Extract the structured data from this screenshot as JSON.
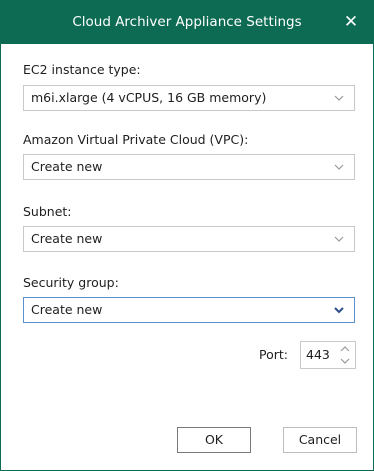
{
  "dialog": {
    "title": "Cloud Archiver Appliance Settings",
    "close_glyph": "✕"
  },
  "fields": {
    "instance_type": {
      "label": "EC2 instance type:",
      "value": "m6i.xlarge (4 vCPUS, 16 GB memory)"
    },
    "vpc": {
      "label": "Amazon Virtual Private Cloud (VPC):",
      "value": "Create new"
    },
    "subnet": {
      "label": "Subnet:",
      "value": "Create new"
    },
    "security_group": {
      "label": "Security group:",
      "value": "Create new"
    }
  },
  "port": {
    "label": "Port:",
    "value": "443"
  },
  "buttons": {
    "ok": "OK",
    "cancel": "Cancel"
  },
  "colors": {
    "titlebar": "#0c6b52",
    "focus_border": "#5b8fd0",
    "chevron_inactive": "#9a9a9a",
    "chevron_active": "#2d4f8a"
  },
  "icons": {
    "close": "close-icon",
    "dropdown": "chevron-down-icon",
    "spin_up": "chevron-up-icon",
    "spin_down": "chevron-down-icon"
  }
}
